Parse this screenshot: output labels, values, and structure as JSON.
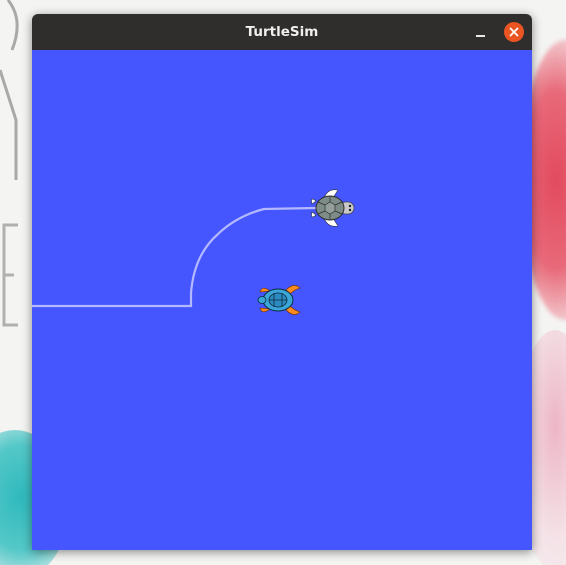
{
  "window": {
    "title": "TurtleSim",
    "buttons": {
      "minimize_icon": "minimize-icon",
      "close_icon": "close-icon"
    }
  },
  "canvas": {
    "background_color": "#4556ff",
    "pen_color": "#b3b8ff"
  },
  "colors": {
    "titlebar": "#2f2e2c",
    "close_button": "#e95420"
  }
}
